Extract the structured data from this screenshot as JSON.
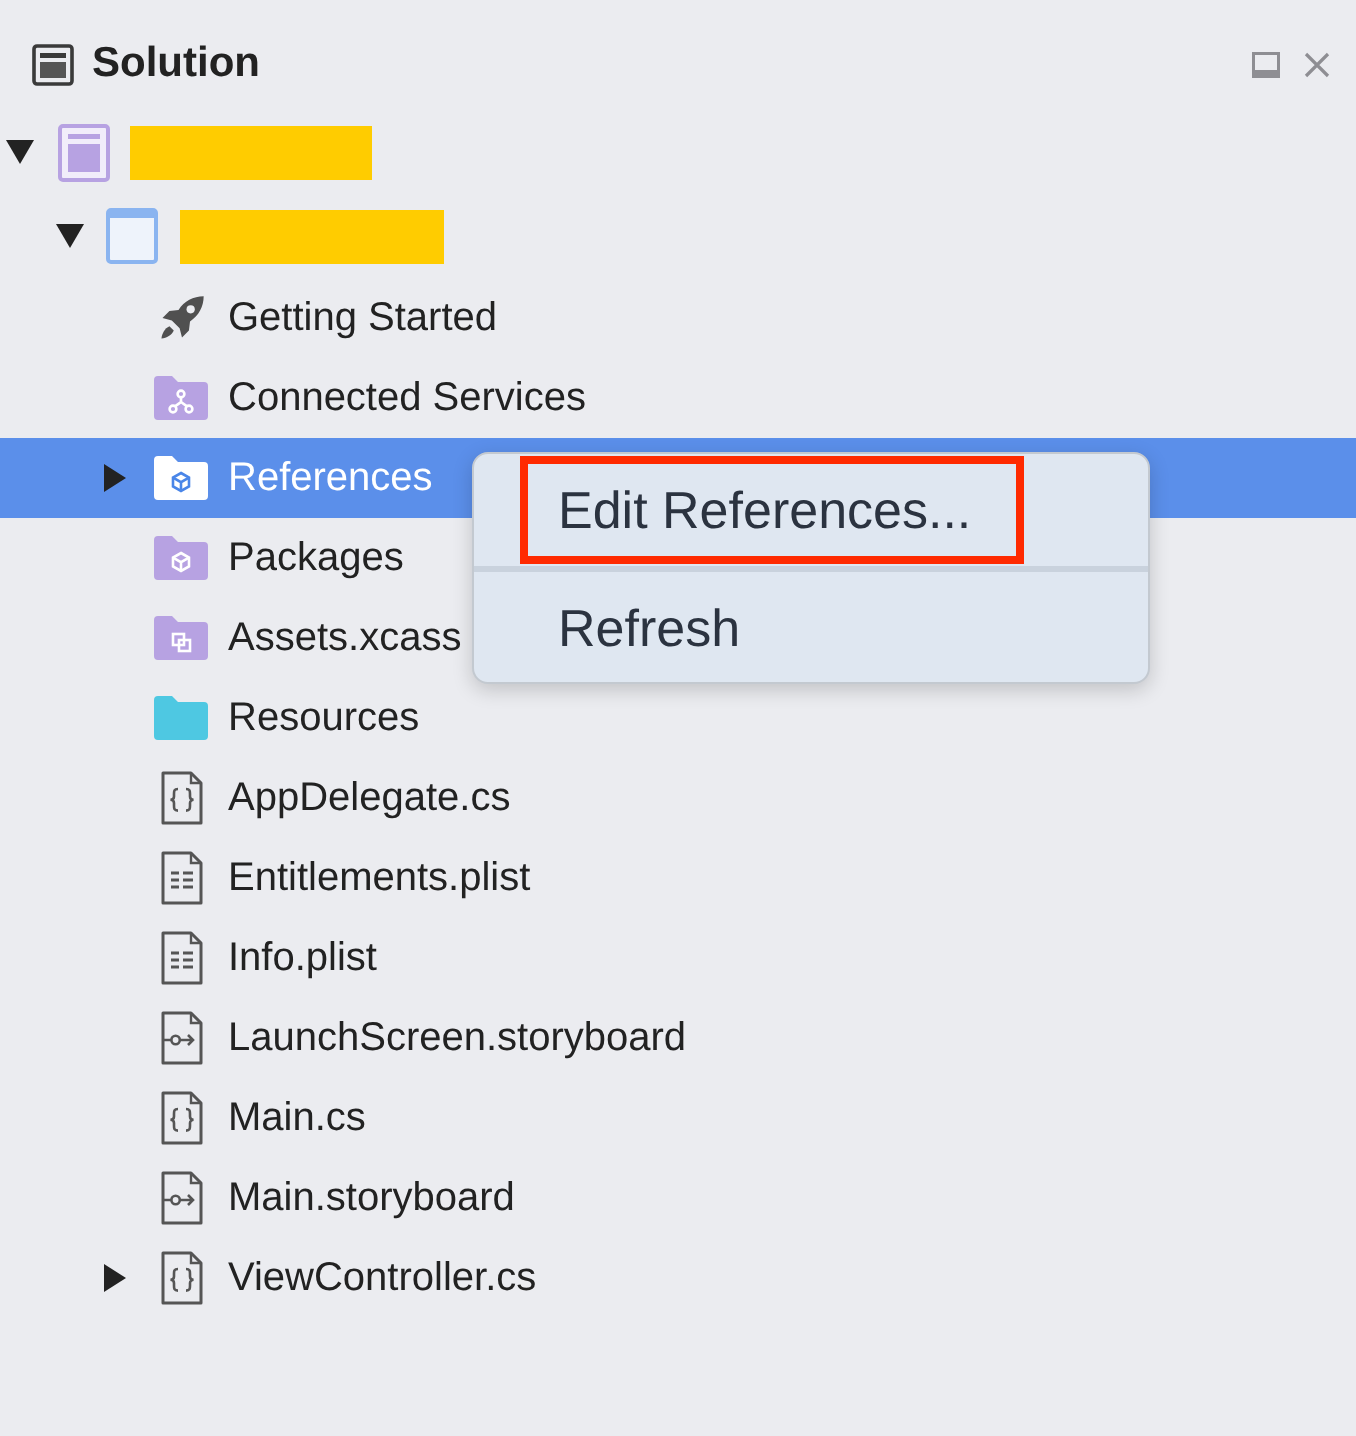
{
  "panel": {
    "title": "Solution"
  },
  "tree": [
    {
      "kind": "solution",
      "redacted": true,
      "expanded": true,
      "selected": false,
      "children": [
        {
          "kind": "project",
          "redacted": true,
          "expanded": true,
          "selected": false,
          "children": [
            {
              "kind": "guide",
              "label": "Getting Started",
              "selected": false
            },
            {
              "kind": "services",
              "label": "Connected Services",
              "selected": false
            },
            {
              "kind": "references",
              "label": "References",
              "expanded": false,
              "selected": true
            },
            {
              "kind": "packages",
              "label": "Packages",
              "selected": false
            },
            {
              "kind": "assets",
              "label": "Assets.xcass",
              "selected": false
            },
            {
              "kind": "folder",
              "label": "Resources",
              "selected": false
            },
            {
              "kind": "code",
              "label": "AppDelegate.cs",
              "selected": false
            },
            {
              "kind": "plist",
              "label": "Entitlements.plist",
              "selected": false
            },
            {
              "kind": "plist",
              "label": "Info.plist",
              "selected": false
            },
            {
              "kind": "storyboard",
              "label": "LaunchScreen.storyboard",
              "selected": false
            },
            {
              "kind": "code",
              "label": "Main.cs",
              "selected": false
            },
            {
              "kind": "storyboard",
              "label": "Main.storyboard",
              "selected": false
            },
            {
              "kind": "code",
              "label": "ViewController.cs",
              "expanded": false,
              "selected": false
            }
          ]
        }
      ]
    }
  ],
  "context_menu": {
    "items": [
      {
        "label": "Edit References...",
        "highlighted": true
      },
      {
        "label": "Refresh",
        "highlighted": false
      }
    ]
  }
}
